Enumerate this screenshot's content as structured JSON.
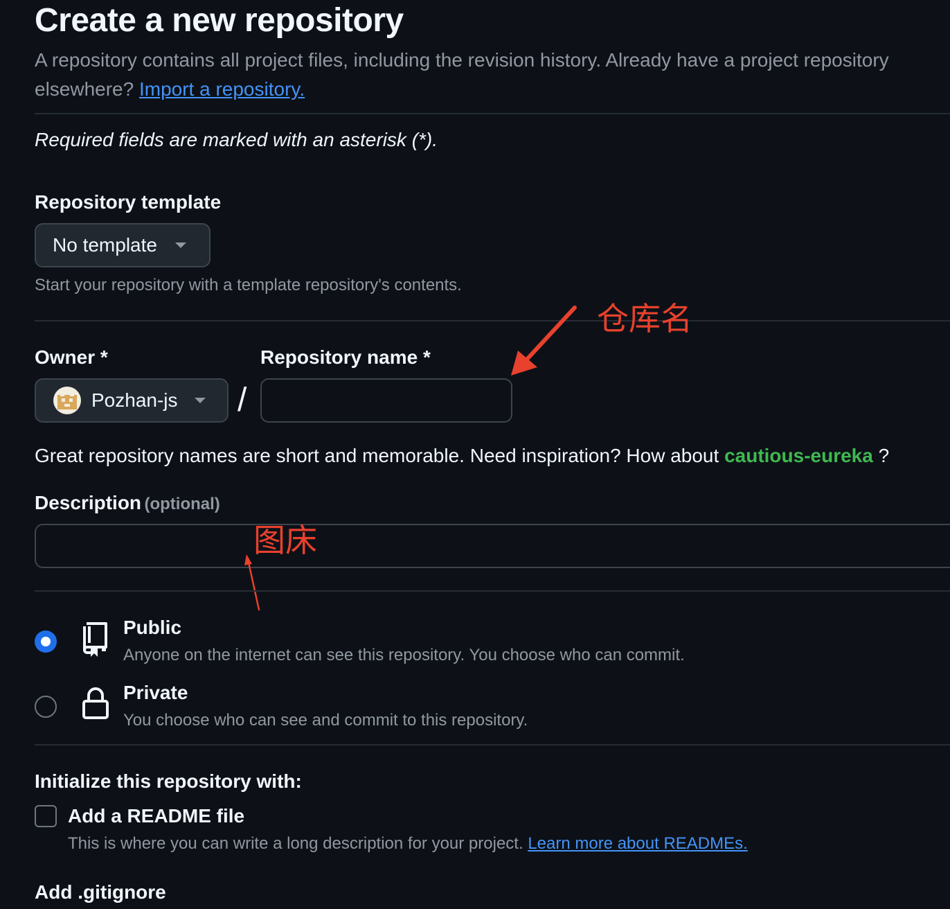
{
  "header": {
    "title": "Create a new repository",
    "subtitle": "A repository contains all project files, including the revision history. Already have a project repository elsewhere?",
    "import_link": "Import a repository."
  },
  "required_note": "Required fields are marked with an asterisk (*).",
  "template": {
    "label": "Repository template",
    "selected": "No template",
    "help": "Start your repository with a template repository's contents."
  },
  "owner": {
    "label": "Owner *",
    "selected": "Pozhan-js"
  },
  "separator": "/",
  "repo_name": {
    "label": "Repository name *",
    "value": ""
  },
  "name_hint": {
    "text": "Great repository names are short and memorable. Need inspiration? How about",
    "suggestion": "cautious-eureka",
    "suffix": "?"
  },
  "description": {
    "label": "Description",
    "optional": "(optional)",
    "value": ""
  },
  "visibility": {
    "public": {
      "title": "Public",
      "desc": "Anyone on the internet can see this repository. You choose who can commit.",
      "selected": true,
      "icon": "repo-icon"
    },
    "private": {
      "title": "Private",
      "desc": "You choose who can see and commit to this repository.",
      "selected": false,
      "icon": "lock-icon"
    }
  },
  "initialize": {
    "label": "Initialize this repository with:",
    "readme_label": "Add a README file",
    "readme_desc": "This is where you can write a long description for your project.",
    "readme_link": "Learn more about READMEs.",
    "readme_checked": false
  },
  "gitignore": {
    "label": "Add .gitignore"
  },
  "annotations": {
    "repo_name_note": "仓库名",
    "description_note": "图床",
    "color": "#e8412d"
  },
  "colors": {
    "background": "#0d1117",
    "accent": "#1f6feb",
    "link": "#4493f8",
    "suggestion": "#3fb950"
  }
}
